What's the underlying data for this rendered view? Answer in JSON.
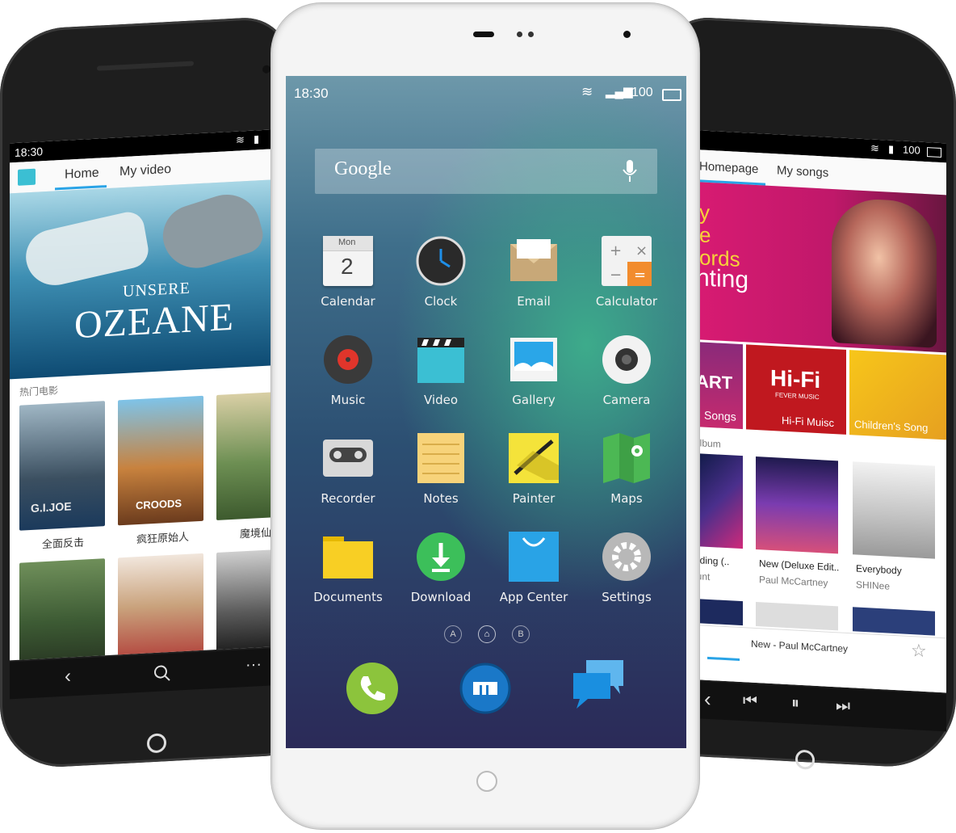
{
  "left_phone": {
    "status_time": "18:30",
    "tabs": [
      "Home",
      "My video"
    ],
    "banner_line1": "UNSERE",
    "banner_line2": "OZEANE",
    "section_label": "热门电影",
    "posters_row1": [
      "全面反击",
      "疯狂原始人",
      "魔境仙"
    ],
    "poster_logo_1": "G.I.JOE",
    "poster_logo_2": "CROODS",
    "nav_icons": [
      "back-icon",
      "search-icon",
      "more-icon"
    ],
    "more_glyph": "···"
  },
  "center_phone": {
    "status_time": "18:30",
    "battery": "100",
    "search_placeholder": "Google",
    "calendar_day_name": "Mon",
    "calendar_day_number": "2",
    "apps": [
      {
        "label": "Calendar",
        "icon": "calendar-icon"
      },
      {
        "label": "Clock",
        "icon": "clock-icon"
      },
      {
        "label": "Email",
        "icon": "email-icon"
      },
      {
        "label": "Calculator",
        "icon": "calculator-icon"
      },
      {
        "label": "Music",
        "icon": "music-icon"
      },
      {
        "label": "Video",
        "icon": "video-icon"
      },
      {
        "label": "Gallery",
        "icon": "gallery-icon"
      },
      {
        "label": "Camera",
        "icon": "camera-icon"
      },
      {
        "label": "Recorder",
        "icon": "recorder-icon"
      },
      {
        "label": "Notes",
        "icon": "notes-icon"
      },
      {
        "label": "Painter",
        "icon": "painter-icon"
      },
      {
        "label": "Maps",
        "icon": "maps-icon"
      },
      {
        "label": "Documents",
        "icon": "documents-icon"
      },
      {
        "label": "Download",
        "icon": "download-icon"
      },
      {
        "label": "App Center",
        "icon": "app-center-icon"
      },
      {
        "label": "Settings",
        "icon": "settings-icon"
      }
    ],
    "page_dots": [
      "A",
      "⌂",
      "B"
    ],
    "dock": [
      "phone-icon",
      "browser-icon",
      "messages-icon"
    ]
  },
  "right_phone": {
    "battery": "100",
    "tabs": [
      "Homepage",
      "My songs"
    ],
    "banner_text": [
      "y",
      "e",
      "ords",
      "nting"
    ],
    "tiles": [
      "Songs",
      "Hi-Fi Muisc",
      "Children's Song"
    ],
    "hifi_label": "Hi-Fi",
    "hifi_sub": "FEVER MUSIC",
    "tile1_text": "ART",
    "section_label": "album",
    "albums": [
      {
        "title": "nding (..",
        "artist": "lunt"
      },
      {
        "title": "New (Deluxe Edit..",
        "artist": "Paul McCartney"
      },
      {
        "title": "Everybody",
        "artist": "SHINee"
      }
    ],
    "now_playing": "New - Paul McCartney",
    "controls": [
      "back-icon",
      "previous-icon",
      "pause-icon",
      "next-icon"
    ]
  },
  "colors": {
    "center_gradient_top": "#5d8fa0",
    "center_gradient_bottom": "#2b2a58",
    "accent_blue": "#29a3e6",
    "right_banner": "#d81b72"
  }
}
